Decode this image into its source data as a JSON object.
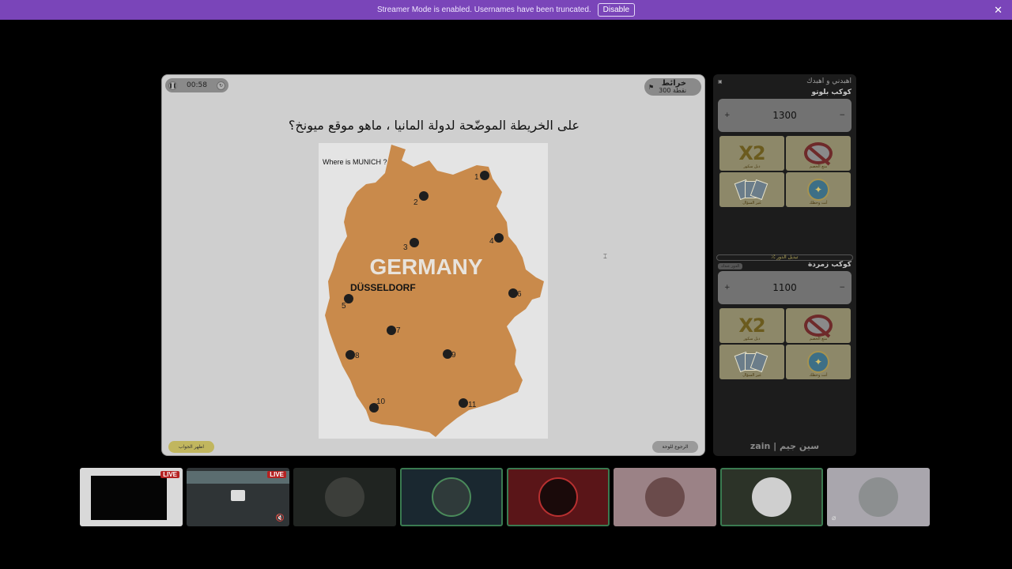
{
  "banner": {
    "text": "Streamer Mode is enabled. Usernames have been truncated.",
    "button": "Disable",
    "close": "✕"
  },
  "game": {
    "timer": "00:58",
    "category": "خرائط",
    "points": "300 نقطة",
    "question": "على الخريطة الموضّحة لدولة المانيا ، ماهو موقع ميونخ؟",
    "map_label": "Where is MUNICH ?",
    "map_title": "GERMANY",
    "city": "DÜSSELDORF",
    "markers": [
      "1",
      "2",
      "3",
      "4",
      "5",
      "6",
      "7",
      "8",
      "9",
      "10",
      "11"
    ],
    "show_answer": "اظهر الجواب",
    "back_board": "الرجوع للوحة"
  },
  "side": {
    "header": "اهبدني و اهبدك",
    "header_icon_label": "اللوحة",
    "team1": {
      "name": "كوكب بلوتو",
      "score": "1300"
    },
    "team2": {
      "name": "كوكب زمردة",
      "score": "1100",
      "turn_badge": "الدور عندك"
    },
    "switch_turn": "⤮ تبديل الدور",
    "cards": [
      {
        "name": "x2-card",
        "label": "دبل سكور"
      },
      {
        "name": "stop-card",
        "label": "منع الخصم"
      },
      {
        "name": "cards-card",
        "label": "غير السؤال"
      },
      {
        "name": "clock-card",
        "label": "أنت وحظك"
      }
    ],
    "logo": "zain | سين جيم"
  },
  "streams": {
    "live": "LIVE"
  },
  "colors": {
    "banner": "#7a45b9",
    "map_fill": "#c98a4b"
  }
}
